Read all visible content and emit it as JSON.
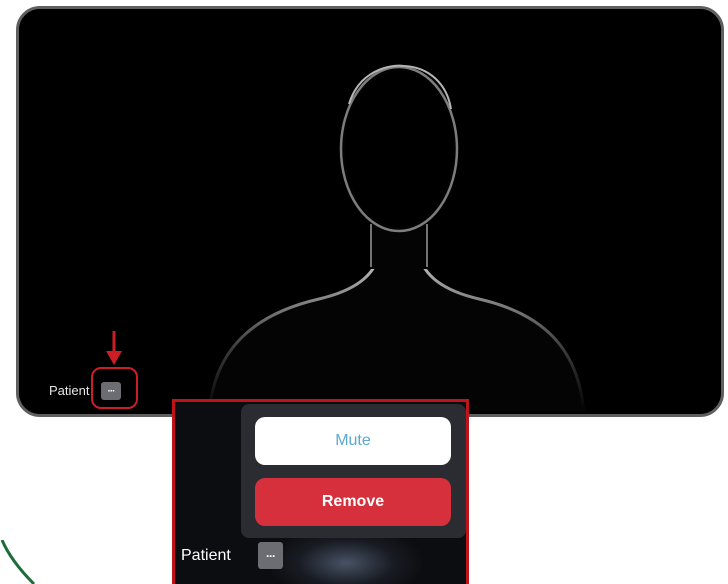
{
  "video": {
    "participant_name": "Patient",
    "more_button_label": "···"
  },
  "callout": {
    "participant_name": "Patient",
    "more_button_label": "···",
    "menu": {
      "mute_label": "Mute",
      "remove_label": "Remove"
    }
  },
  "colors": {
    "highlight": "#cc1f25",
    "remove": "#d5303b",
    "mute_text": "#5ba8d0",
    "tile_border": "#5f5f5f"
  },
  "icons": {
    "annotation_arrow": "red-down-arrow-icon",
    "more": "ellipsis-icon",
    "corner": "green-arc-decoration"
  }
}
